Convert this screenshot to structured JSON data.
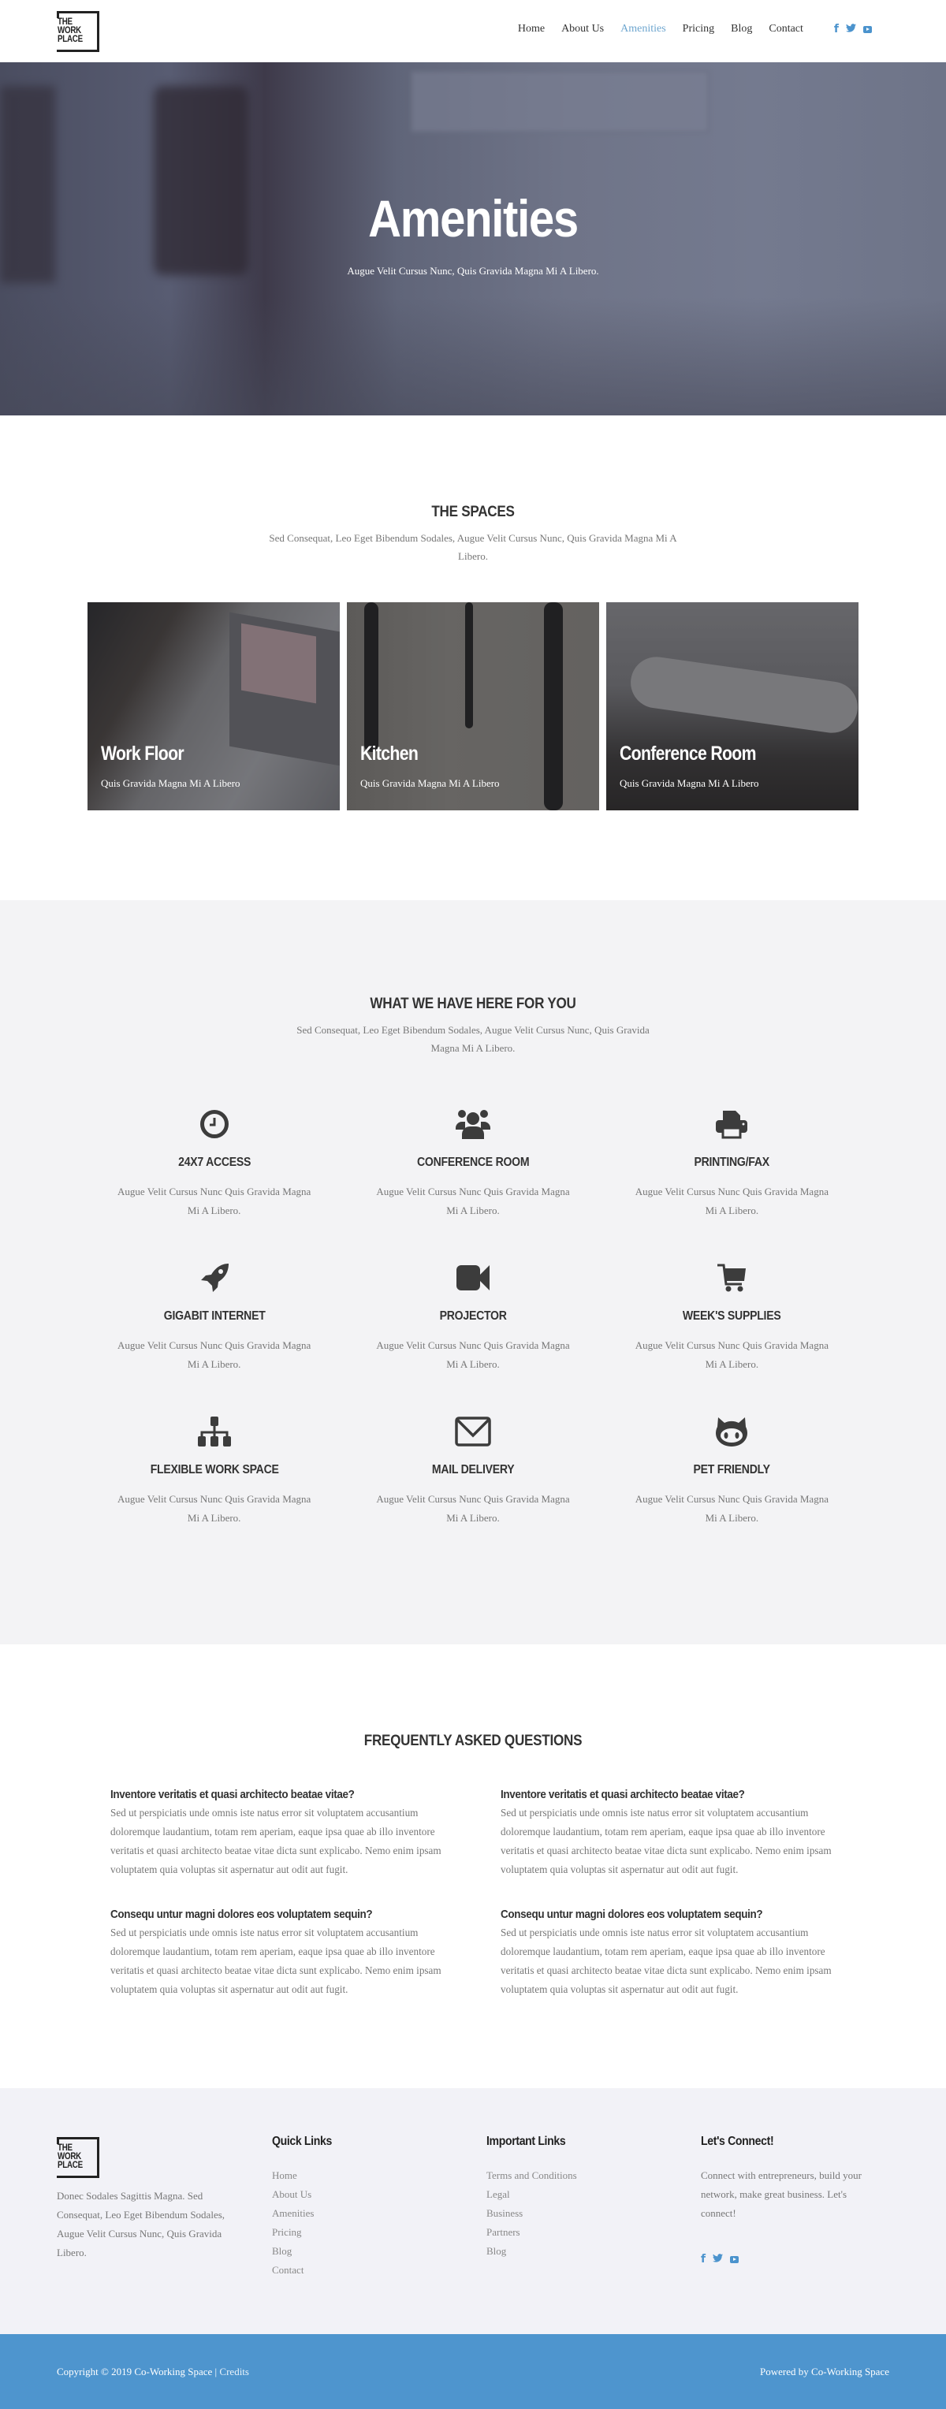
{
  "header": {
    "logo_lines": [
      "THE",
      "WORK",
      "PLACE"
    ],
    "nav": [
      {
        "label": "Home",
        "active": false
      },
      {
        "label": "About Us",
        "active": false
      },
      {
        "label": "Amenities",
        "active": true
      },
      {
        "label": "Pricing",
        "active": false
      },
      {
        "label": "Blog",
        "active": false
      },
      {
        "label": "Contact",
        "active": false
      }
    ],
    "social_icons": [
      "facebook-icon",
      "twitter-icon",
      "youtube-icon"
    ]
  },
  "hero": {
    "title": "Amenities",
    "subtitle": "Augue Velit Cursus Nunc, Quis Gravida Magna Mi A Libero."
  },
  "spaces": {
    "title": "THE SPACES",
    "subtitle": "Sed Consequat, Leo Eget Bibendum Sodales, Augue Velit Cursus Nunc, Quis Gravida Magna Mi A Libero.",
    "cards": [
      {
        "title": "Work Floor",
        "caption": "Quis Gravida Magna Mi A Libero"
      },
      {
        "title": "Kitchen",
        "caption": "Quis Gravida Magna Mi A Libero"
      },
      {
        "title": "Conference Room",
        "caption": "Quis Gravida Magna Mi A Libero"
      }
    ]
  },
  "features": {
    "title": "WHAT WE HAVE HERE FOR YOU",
    "subtitle": "Sed Consequat, Leo Eget Bibendum Sodales, Augue Velit Cursus Nunc, Quis Gravida Magna Mi A Libero.",
    "items": [
      {
        "icon": "clock-icon",
        "title": "24X7 ACCESS",
        "text": "Augue Velit Cursus Nunc Quis Gravida Magna Mi A Libero."
      },
      {
        "icon": "users-icon",
        "title": "CONFERENCE ROOM",
        "text": "Augue Velit Cursus Nunc Quis Gravida Magna Mi A Libero."
      },
      {
        "icon": "printer-icon",
        "title": "PRINTING/FAX",
        "text": "Augue Velit Cursus Nunc Quis Gravida Magna Mi A Libero."
      },
      {
        "icon": "rocket-icon",
        "title": "GIGABIT INTERNET",
        "text": "Augue Velit Cursus Nunc Quis Gravida Magna Mi A Libero."
      },
      {
        "icon": "video-camera-icon",
        "title": "PROJECTOR",
        "text": "Augue Velit Cursus Nunc Quis Gravida Magna Mi A Libero."
      },
      {
        "icon": "cart-icon",
        "title": "WEEK'S SUPPLIES",
        "text": "Augue Velit Cursus Nunc Quis Gravida Magna Mi A Libero."
      },
      {
        "icon": "sitemap-icon",
        "title": "FLEXIBLE WORK SPACE",
        "text": "Augue Velit Cursus Nunc Quis Gravida Magna Mi A Libero."
      },
      {
        "icon": "envelope-icon",
        "title": "MAIL DELIVERY",
        "text": "Augue Velit Cursus Nunc Quis Gravida Magna Mi A Libero."
      },
      {
        "icon": "octocat-icon",
        "title": "PET FRIENDLY",
        "text": "Augue Velit Cursus Nunc Quis Gravida Magna Mi A Libero."
      }
    ]
  },
  "faq": {
    "title": "FREQUENTLY ASKED QUESTIONS",
    "items": [
      {
        "q": "Inventore veritatis et quasi architecto beatae vitae?",
        "a": "Sed ut perspiciatis unde omnis iste natus error sit voluptatem accusantium doloremque laudantium, totam rem aperiam, eaque ipsa quae ab illo inventore veritatis et quasi architecto beatae vitae dicta sunt explicabo. Nemo enim ipsam voluptatem quia voluptas sit aspernatur aut odit aut fugit."
      },
      {
        "q": "Inventore veritatis et quasi architecto beatae vitae?",
        "a": "Sed ut perspiciatis unde omnis iste natus error sit voluptatem accusantium doloremque laudantium, totam rem aperiam, eaque ipsa quae ab illo inventore veritatis et quasi architecto beatae vitae dicta sunt explicabo. Nemo enim ipsam voluptatem quia voluptas sit aspernatur aut odit aut fugit."
      },
      {
        "q": "Consequ untur magni dolores eos voluptatem sequin?",
        "a": "Sed ut perspiciatis unde omnis iste natus error sit voluptatem accusantium doloremque laudantium, totam rem aperiam, eaque ipsa quae ab illo inventore veritatis et quasi architecto beatae vitae dicta sunt explicabo. Nemo enim ipsam voluptatem quia voluptas sit aspernatur aut odit aut fugit."
      },
      {
        "q": "Consequ untur magni dolores eos voluptatem sequin?",
        "a": "Sed ut perspiciatis unde omnis iste natus error sit voluptatem accusantium doloremque laudantium, totam rem aperiam, eaque ipsa quae ab illo inventore veritatis et quasi architecto beatae vitae dicta sunt explicabo. Nemo enim ipsam voluptatem quia voluptas sit aspernatur aut odit aut fugit."
      }
    ]
  },
  "footer": {
    "description": "Donec Sodales Sagittis Magna. Sed Consequat, Leo Eget Bibendum Sodales, Augue Velit Cursus Nunc, Quis Gravida Libero.",
    "quick_links": {
      "title": "Quick Links",
      "links": [
        "Home",
        "About Us",
        "Amenities",
        "Pricing",
        "Blog",
        "Contact"
      ]
    },
    "important_links": {
      "title": "Important Links",
      "links": [
        "Terms and Conditions",
        "Legal",
        "Business",
        "Partners",
        "Blog"
      ]
    },
    "connect": {
      "title": "Let's Connect!",
      "text": "Connect with entrepreneurs, build your network, make great business. Let's connect!"
    },
    "copyright": "Copyright © 2019 Co-Working Space | ",
    "credits_label": "Credits",
    "powered_by": "Powered by Co-Working Space"
  },
  "colors": {
    "accent": "#4b93cd",
    "nav_active": "#6ea6cf",
    "bottom_bar": "#4e95ce",
    "section_gray": "#f3f3f5"
  }
}
